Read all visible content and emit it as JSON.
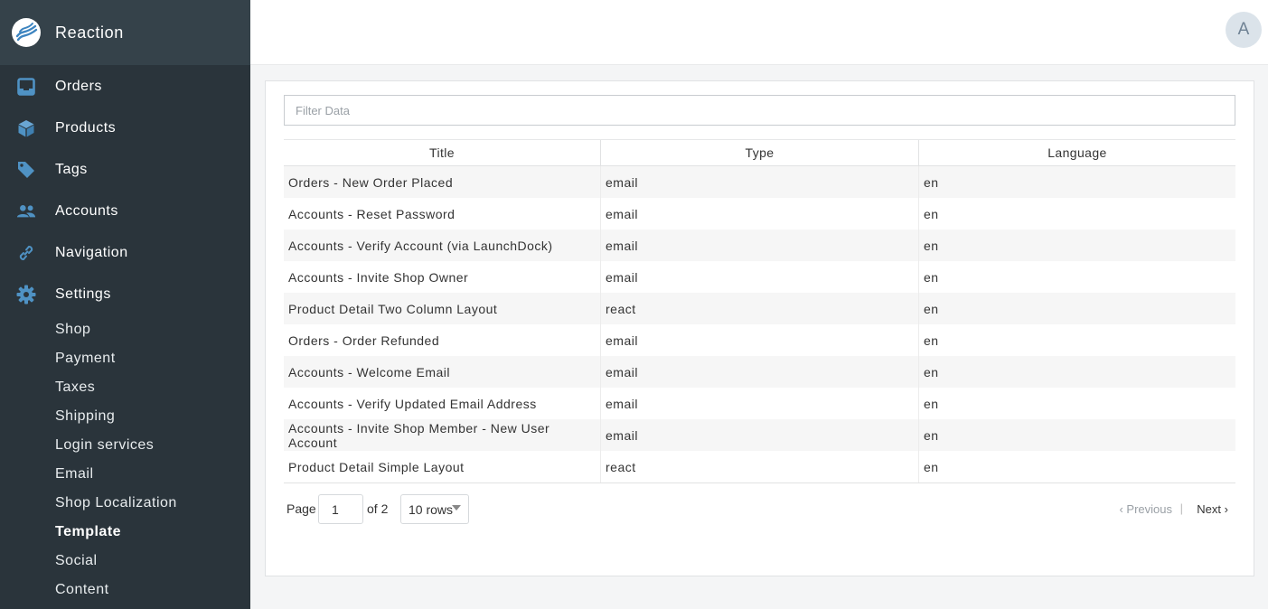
{
  "brand": {
    "name": "Reaction"
  },
  "sidebar": {
    "items": [
      {
        "label": "Orders",
        "icon": "inbox-icon"
      },
      {
        "label": "Products",
        "icon": "cube-icon"
      },
      {
        "label": "Tags",
        "icon": "tag-icon"
      },
      {
        "label": "Accounts",
        "icon": "users-icon"
      },
      {
        "label": "Navigation",
        "icon": "link-icon"
      },
      {
        "label": "Settings",
        "icon": "gear-icon"
      }
    ],
    "settings_items": [
      "Shop",
      "Payment",
      "Taxes",
      "Shipping",
      "Login services",
      "Email",
      "Shop Localization",
      "Template",
      "Social",
      "Content"
    ],
    "active_item": "Template"
  },
  "header": {
    "avatar_initial": "A"
  },
  "filter": {
    "placeholder": "Filter Data",
    "value": ""
  },
  "table": {
    "columns": [
      "Title",
      "Type",
      "Language"
    ],
    "rows": [
      [
        "Orders - New Order Placed",
        "email",
        "en"
      ],
      [
        "Accounts - Reset Password",
        "email",
        "en"
      ],
      [
        "Accounts - Verify Account (via LaunchDock)",
        "email",
        "en"
      ],
      [
        "Accounts - Invite Shop Owner",
        "email",
        "en"
      ],
      [
        "Product Detail Two Column Layout",
        "react",
        "en"
      ],
      [
        "Orders - Order Refunded",
        "email",
        "en"
      ],
      [
        "Accounts - Welcome Email",
        "email",
        "en"
      ],
      [
        "Accounts - Verify Updated Email Address",
        "email",
        "en"
      ],
      [
        "Accounts - Invite Shop Member - New User Account",
        "email",
        "en"
      ],
      [
        "Product Detail Simple Layout",
        "react",
        "en"
      ]
    ]
  },
  "pagination": {
    "page_label": "Page",
    "current_page": "1",
    "of_label": "of 2",
    "rows_option": "10 rows",
    "previous_label": "Previous",
    "next_label": "Next",
    "separator": "|"
  },
  "colors": {
    "sidebar_bg": "#2a343b",
    "brand_bg": "#35424a",
    "icon_blue": "#4f92c4"
  }
}
